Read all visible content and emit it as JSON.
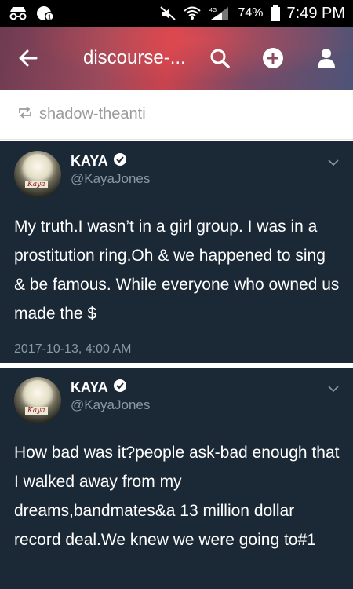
{
  "status_bar": {
    "battery": "74%",
    "time": "7:49 PM"
  },
  "header": {
    "title": "discourse-..."
  },
  "reblog": {
    "username": "shadow-theanti"
  },
  "tweets": [
    {
      "display_name": "KAYA",
      "handle": "@KayaJones",
      "avatar_label": "Kaya",
      "text": "My truth.I wasn’t in a girl group. I was in a prostitution ring.Oh & we happened to sing & be famous. While everyone who owned us made the $",
      "date": "2017-10-13, 4:00 AM"
    },
    {
      "display_name": "KAYA",
      "handle": "@KayaJones",
      "avatar_label": "Kaya",
      "text": "How bad was it?people ask-bad enough that I walked away from my dreams,bandmates&a 13 million dollar record deal.We knew we were going to#1",
      "date": ""
    }
  ],
  "colors": {
    "tweet_bg": "#1b2836",
    "muted_text": "#8899a6",
    "header_accent": "#c9434e"
  },
  "icons": [
    "incognito-icon",
    "notification-icon",
    "mute-icon",
    "wifi-icon",
    "signal-icon",
    "battery-icon",
    "back-arrow-icon",
    "search-icon",
    "compose-icon",
    "account-icon",
    "reblog-icon",
    "verified-icon",
    "chevron-down-icon"
  ]
}
